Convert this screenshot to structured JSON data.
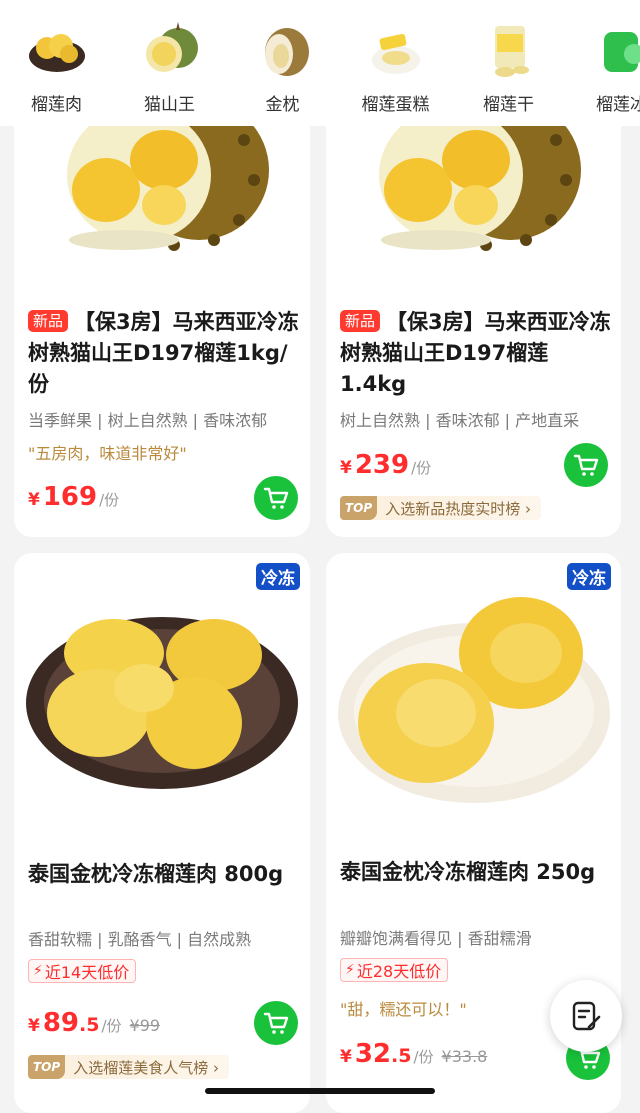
{
  "categories": [
    {
      "label": "榴莲肉",
      "icon": "durian-flesh-icon"
    },
    {
      "label": "猫山王",
      "icon": "musang-king-icon"
    },
    {
      "label": "金枕",
      "icon": "monthong-icon"
    },
    {
      "label": "榴莲蛋糕",
      "icon": "durian-cake-icon"
    },
    {
      "label": "榴莲干",
      "icon": "dried-durian-icon"
    },
    {
      "label": "榴莲冰",
      "icon": "durian-ice-icon"
    }
  ],
  "products": [
    {
      "badge": "新品",
      "title": "【保3房】马来西亚冷冻树熟猫山王D197榴莲1kg/份",
      "tags": "当季鲜果 | 树上自然熟 | 香味浓郁",
      "quote": "\"五房肉，味道非常好\"",
      "currency": "¥",
      "price_int": "169",
      "price_dec": "",
      "unit": "/份",
      "old_price": ""
    },
    {
      "badge": "新品",
      "title": "【保3房】马来西亚冷冻树熟猫山王D197榴莲1.4kg",
      "tags": "树上自然熟 | 香味浓郁 | 产地直采",
      "currency": "¥",
      "price_int": "239",
      "price_dec": "",
      "unit": "/份",
      "rank_tag": "TOP",
      "rank_text": "入选新品热度实时榜 ›"
    },
    {
      "frozen": "冷冻",
      "title": "泰国金枕冷冻榴莲肉 800g",
      "tags": "香甜软糯 | 乳酪香气 | 自然成熟",
      "low_price": "近14天低价",
      "currency": "¥",
      "price_int": "89",
      "price_dec": ".5",
      "unit": "/份",
      "old_price": "¥99",
      "rank_tag": "TOP",
      "rank_text": "入选榴莲美食人气榜 ›"
    },
    {
      "frozen": "冷冻",
      "title": "泰国金枕冷冻榴莲肉 250g",
      "tags": "瓣瓣饱满看得见 | 香甜糯滑",
      "low_price": "近28天低价",
      "quote": "\"甜，糯还可以！\"",
      "currency": "¥",
      "price_int": "32",
      "price_dec": ".5",
      "unit": "/份",
      "old_price": "¥33.8"
    }
  ],
  "colors": {
    "price": "#ff2d2d",
    "cart": "#19c23a",
    "frozen_badge": "#1350c8"
  }
}
